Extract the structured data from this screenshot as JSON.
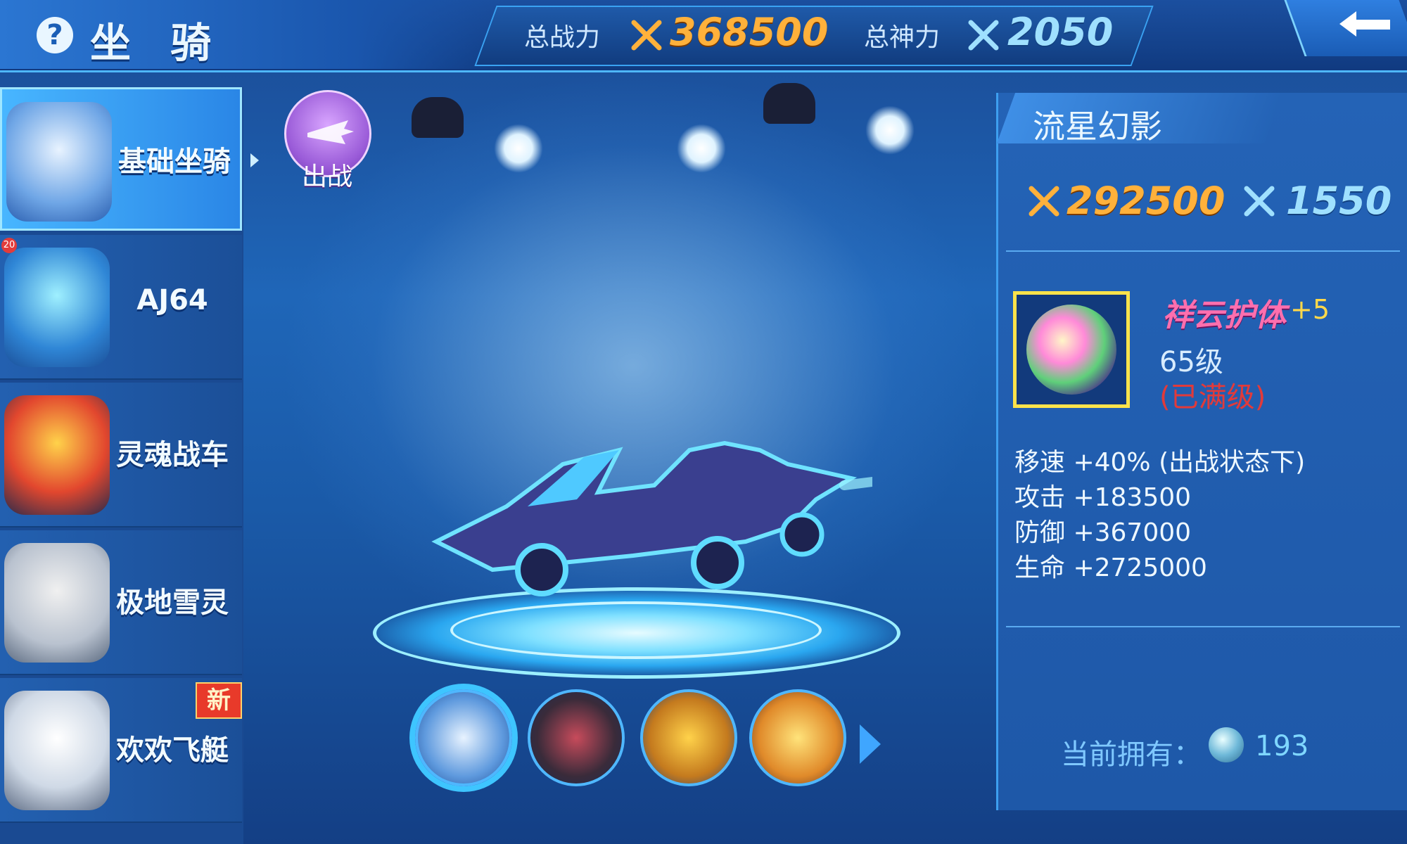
{
  "header": {
    "help_icon": "question-icon",
    "title": "坐 骑",
    "total_power_label": "总战力",
    "total_power_value": "368500",
    "total_divine_label": "总神力",
    "total_divine_value": "2050",
    "back_icon": "back-arrow-icon"
  },
  "sidebar": {
    "items": [
      {
        "label": "基础坐骑",
        "active": true
      },
      {
        "label": "AJ64",
        "badge": "20"
      },
      {
        "label": "灵魂战车"
      },
      {
        "label": "极地雪灵"
      },
      {
        "label": "欢欢飞艇",
        "tag": "新"
      }
    ]
  },
  "deploy": {
    "label": "出战"
  },
  "mount_detail": {
    "name": "流星幻影",
    "power": "292500",
    "divine": "1550",
    "skill": {
      "name": "祥云护体",
      "plus": "+5",
      "level": "65级",
      "max_note": "(已满级)"
    },
    "attributes": [
      "移速 +40% (出战状态下)",
      "攻击 +183500",
      "防御 +367000",
      "生命 +2725000"
    ],
    "owned_label": "当前拥有：",
    "owned_count": "193"
  },
  "colors": {
    "power_orange": "#ffb13b",
    "divine_blue": "#9fe0ff",
    "skill_frame": "#ffe34a",
    "max_red": "#e23a3a"
  }
}
